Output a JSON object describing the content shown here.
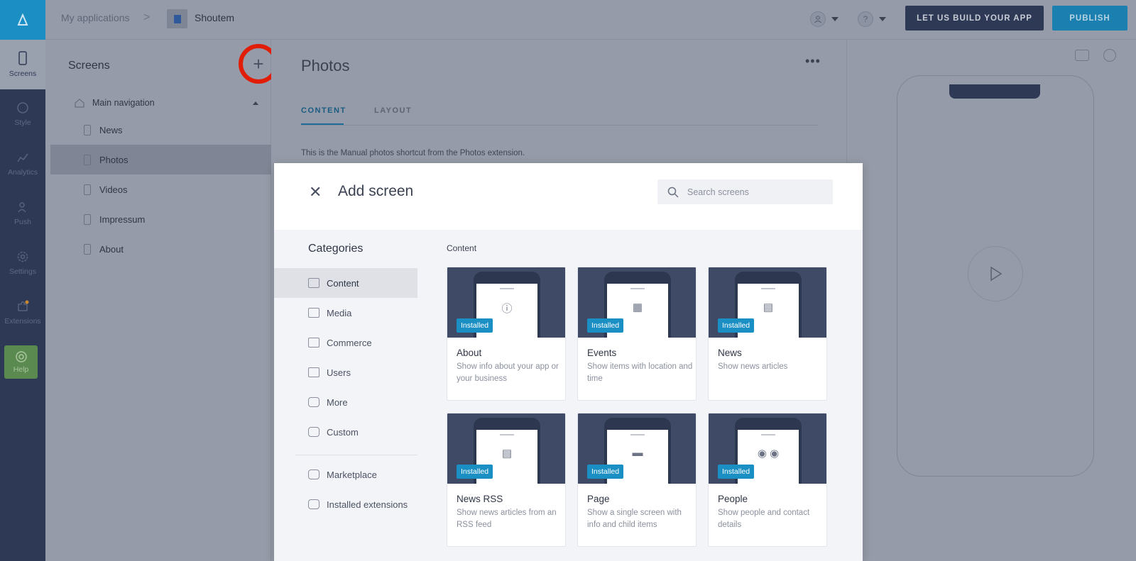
{
  "rail": {
    "items": [
      {
        "label": "Screens",
        "icon": "phone-icon"
      },
      {
        "label": "Style",
        "icon": "palette-icon"
      },
      {
        "label": "Analytics",
        "icon": "chart-icon"
      },
      {
        "label": "Push",
        "icon": "push-icon"
      },
      {
        "label": "Settings",
        "icon": "gear-icon"
      },
      {
        "label": "Extensions",
        "icon": "puzzle-icon"
      }
    ],
    "help_label": "Help"
  },
  "topbar": {
    "breadcrumb_root": "My applications",
    "breadcrumb_sep": ">",
    "app_name": "Shoutem",
    "build_button": "LET US BUILD YOUR APP",
    "publish_button": "PUBLISH"
  },
  "screens_panel": {
    "title": "Screens",
    "add_symbol": "+",
    "main_nav": "Main navigation",
    "items": [
      "News",
      "Photos",
      "Videos",
      "Impressum",
      "About"
    ],
    "selected": "Photos"
  },
  "editor": {
    "title": "Photos",
    "more": "•••",
    "tabs": [
      "CONTENT",
      "LAYOUT"
    ],
    "description": "This is the Manual photos shortcut from the Photos extension."
  },
  "modal": {
    "title": "Add screen",
    "close_symbol": "✕",
    "search_placeholder": "Search screens",
    "categories_title": "Categories",
    "categories": [
      "Content",
      "Media",
      "Commerce",
      "Users",
      "More",
      "Custom"
    ],
    "extra_categories": [
      "Marketplace",
      "Installed extensions"
    ],
    "selected_category": "Content",
    "section_label": "Content",
    "badge": "Installed",
    "cards": [
      {
        "name": "About",
        "desc": "Show info about your app or your business",
        "glyph": "ⓘ"
      },
      {
        "name": "Events",
        "desc": "Show items with location and time",
        "glyph": "▦"
      },
      {
        "name": "News",
        "desc": "Show news articles",
        "glyph": "▤"
      },
      {
        "name": "News RSS",
        "desc": "Show news articles from an RSS feed",
        "glyph": "▤"
      },
      {
        "name": "Page",
        "desc": "Show a single screen with info and child items",
        "glyph": "▬"
      },
      {
        "name": "People",
        "desc": "Show people and contact details",
        "glyph": "◉ ◉"
      }
    ]
  },
  "colors": {
    "brand": "#1b8ec3",
    "rail": "#2e3a55",
    "badge": "#1a8fc3",
    "highlight_ring": "#e11d07"
  }
}
